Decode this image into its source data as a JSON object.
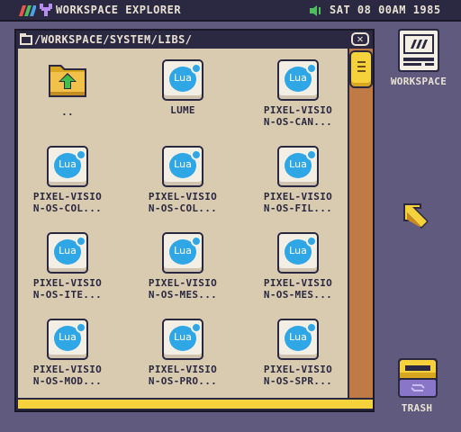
{
  "topbar": {
    "app_title": "WORKSPACE EXPLORER",
    "clock": "SAT 08 00AM 1985"
  },
  "window": {
    "path": "/WORKSPACE/SYSTEM/LIBS/",
    "close_glyph": "✕"
  },
  "items": [
    {
      "label": "..",
      "icon": "folder-up-icon"
    },
    {
      "label": "LUME",
      "icon": "lua-file-icon",
      "badge": "Lua"
    },
    {
      "label": "PIXEL-VISIO\nN-OS-CAN...",
      "icon": "lua-file-icon",
      "badge": "Lua"
    },
    {
      "label": "PIXEL-VISIO\nN-OS-COL...",
      "icon": "lua-file-icon",
      "badge": "Lua"
    },
    {
      "label": "PIXEL-VISIO\nN-OS-COL...",
      "icon": "lua-file-icon",
      "badge": "Lua"
    },
    {
      "label": "PIXEL-VISIO\nN-OS-FIL...",
      "icon": "lua-file-icon",
      "badge": "Lua"
    },
    {
      "label": "PIXEL-VISIO\nN-OS-ITE...",
      "icon": "lua-file-icon",
      "badge": "Lua"
    },
    {
      "label": "PIXEL-VISIO\nN-OS-MES...",
      "icon": "lua-file-icon",
      "badge": "Lua"
    },
    {
      "label": "PIXEL-VISIO\nN-OS-MES...",
      "icon": "lua-file-icon",
      "badge": "Lua"
    },
    {
      "label": "PIXEL-VISIO\nN-OS-MOD...",
      "icon": "lua-file-icon",
      "badge": "Lua"
    },
    {
      "label": "PIXEL-VISIO\nN-OS-PRO...",
      "icon": "lua-file-icon",
      "badge": "Lua"
    },
    {
      "label": "PIXEL-VISIO\nN-OS-SPR...",
      "icon": "lua-file-icon",
      "badge": "Lua"
    }
  ],
  "desktop": {
    "workspace_label": "WORKSPACE",
    "trash_label": "TRASH"
  },
  "colors": {
    "desktop_bg": "#5f5a7e",
    "bar_bg": "#2b2841",
    "window_content": "#d9cbb0",
    "scroll_track": "#c07a45",
    "accent_yellow": "#f5d23c",
    "lua_blue": "#2fa6e5"
  }
}
